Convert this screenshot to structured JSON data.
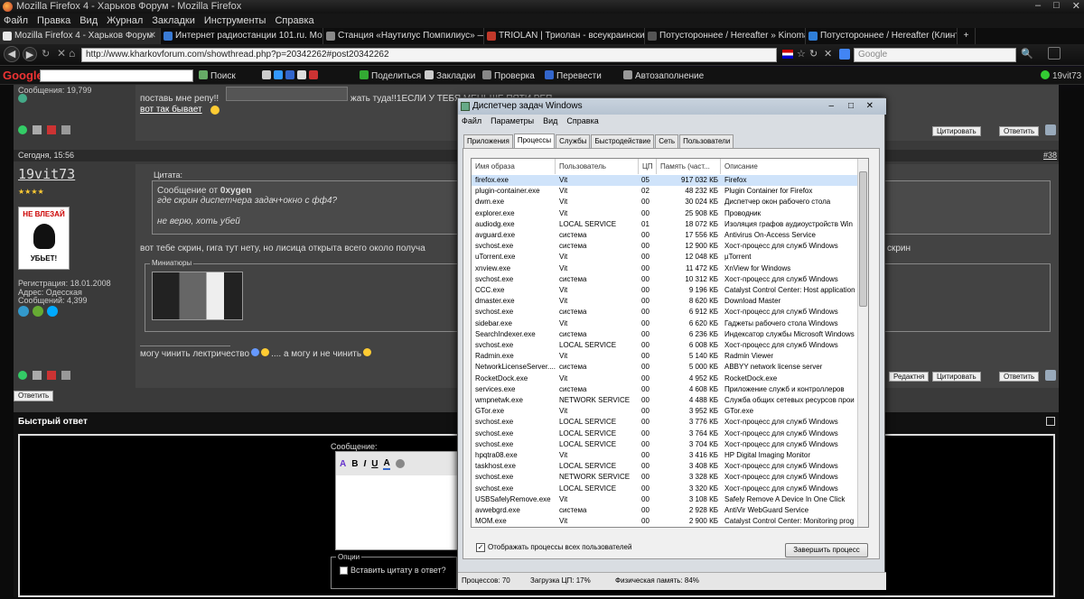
{
  "window": {
    "title": "Mozilla Firefox 4 - Харьков Форум - Mozilla Firefox"
  },
  "menubar": [
    "Файл",
    "Правка",
    "Вид",
    "Журнал",
    "Закладки",
    "Инструменты",
    "Справка"
  ],
  "tabs": [
    {
      "label": "Mozilla Firefox 4 - Харьков Форум",
      "color": "#e8e8e8"
    },
    {
      "label": "Интернет радиостанции 101.ru. Мо...",
      "color": "#3a7bd5"
    },
    {
      "label": "Станция «Наутилус Помпилиус» —...",
      "color": "#888888"
    },
    {
      "label": "TRIOLAN | Триолан - всеукраински...",
      "color": "#c0392b"
    },
    {
      "label": "Потустороннее / Hereafter » Kinoma...",
      "color": "#555555"
    },
    {
      "label": "Потустороннее / Hereafter (Клинт И...",
      "color": "#2f7ed8"
    }
  ],
  "nav": {
    "url": "http://www.kharkovforum.com/showthread.php?p=20342262#post20342262",
    "search_placeholder": "Google"
  },
  "googlebar": {
    "logo": "Google",
    "search": "Поиск",
    "share": "Поделиться",
    "bookmarks": "Закладки",
    "check": "Проверка",
    "translate": "Перевести",
    "autofill": "Автозаполнение",
    "user": "19vit73"
  },
  "forum": {
    "prev_post": {
      "messages": "Сообщения: 19,799",
      "line1": "поставь мне репу!!",
      "line2": "жать туда!!1ЕСЛИ У ТЕБЯ МЕНЬШЕ ПЯТИ РЕП",
      "line3": "вот так бывает",
      "quote_btn": "Цитировать",
      "reply_btn": "Ответить"
    },
    "post": {
      "date": "Сегодня, 15:56",
      "number": "#38",
      "author": "19vit73",
      "stars": "★★★★",
      "avatar_text1": "НЕ ВЛЕЗАЙ",
      "avatar_text2": "УБЬЕТ!",
      "reg": "Регистрация: 18.01.2008",
      "address": "Адрес: Одесская",
      "messages": "Сообщений: 4,399",
      "quote_label": "Цитата:",
      "quote_from_prefix": "Сообщение от",
      "quote_from": "0xygen",
      "quote_line1": "где скрин диспетчера задач+окно с фф4?",
      "quote_line2": "не верю, хоть убей",
      "text": "вот тебе скрин, гига тут нету, но лисица открыта всего около получа",
      "text_end": "скрин",
      "thumbs_label": "Миниатюры",
      "signature": "могу чинить лектричество",
      "signature2": ".... а могу и не чинить",
      "edit_btn": "Редактня",
      "quote_btn": "Цитировать",
      "reply_btn": "Ответить"
    },
    "reply_button": "Ответить",
    "quick_reply": {
      "title": "Быстрый ответ",
      "message_label": "Сообщение:",
      "options_label": "Опции",
      "quote_checkbox": "Вставить цитату в ответ?"
    }
  },
  "taskmgr": {
    "title": "Диспетчер задач Windows",
    "menu": [
      "Файл",
      "Параметры",
      "Вид",
      "Справка"
    ],
    "tabs": [
      "Приложения",
      "Процессы",
      "Службы",
      "Быстродействие",
      "Сеть",
      "Пользователи"
    ],
    "active_tab": "Процессы",
    "columns": [
      "Имя образа",
      "Пользователь",
      "ЦП",
      "Память (част...",
      "Описание"
    ],
    "rows": [
      [
        "firefox.exe",
        "Vit",
        "05",
        "917 032 КБ",
        "Firefox"
      ],
      [
        "plugin-container.exe",
        "Vit",
        "02",
        "48 232 КБ",
        "Plugin Container for Firefox"
      ],
      [
        "dwm.exe",
        "Vit",
        "00",
        "30 024 КБ",
        "Диспетчер окон рабочего стола"
      ],
      [
        "explorer.exe",
        "Vit",
        "00",
        "25 908 КБ",
        "Проводник"
      ],
      [
        "audiodg.exe",
        "LOCAL SERVICE",
        "01",
        "18 072 КБ",
        "Изоляция графов аудиоустройств Win"
      ],
      [
        "avguard.exe",
        "система",
        "00",
        "17 556 КБ",
        "Antivirus On-Access Service"
      ],
      [
        "svchost.exe",
        "система",
        "00",
        "12 900 КБ",
        "Хост-процесс для служб Windows"
      ],
      [
        "uTorrent.exe",
        "Vit",
        "00",
        "12 048 КБ",
        "µTorrent"
      ],
      [
        "xnview.exe",
        "Vit",
        "00",
        "11 472 КБ",
        "XnView for Windows"
      ],
      [
        "svchost.exe",
        "система",
        "00",
        "10 312 КБ",
        "Хост-процесс для служб Windows"
      ],
      [
        "CCC.exe",
        "Vit",
        "00",
        "9 196 КБ",
        "Catalyst Control Center: Host application"
      ],
      [
        "dmaster.exe",
        "Vit",
        "00",
        "8 620 КБ",
        "Download Master"
      ],
      [
        "svchost.exe",
        "система",
        "00",
        "6 912 КБ",
        "Хост-процесс для служб Windows"
      ],
      [
        "sidebar.exe",
        "Vit",
        "00",
        "6 620 КБ",
        "Гаджеты рабочего стола Windows"
      ],
      [
        "SearchIndexer.exe",
        "система",
        "00",
        "6 236 КБ",
        "Индексатор службы Microsoft Windows"
      ],
      [
        "svchost.exe",
        "LOCAL SERVICE",
        "00",
        "6 008 КБ",
        "Хост-процесс для служб Windows"
      ],
      [
        "Radmin.exe",
        "Vit",
        "00",
        "5 140 КБ",
        "Radmin Viewer"
      ],
      [
        "NetworkLicenseServer....",
        "система",
        "00",
        "5 000 КБ",
        "ABBYY network license server"
      ],
      [
        "RocketDock.exe",
        "Vit",
        "00",
        "4 952 КБ",
        "RocketDock.exe"
      ],
      [
        "services.exe",
        "система",
        "00",
        "4 608 КБ",
        "Приложение служб и контроллеров"
      ],
      [
        "wmpnetwk.exe",
        "NETWORK SERVICE",
        "00",
        "4 488 КБ",
        "Служба общих сетевых ресурсов прои"
      ],
      [
        "GTor.exe",
        "Vit",
        "00",
        "3 952 КБ",
        "GTor.exe"
      ],
      [
        "svchost.exe",
        "LOCAL SERVICE",
        "00",
        "3 776 КБ",
        "Хост-процесс для служб Windows"
      ],
      [
        "svchost.exe",
        "LOCAL SERVICE",
        "00",
        "3 764 КБ",
        "Хост-процесс для служб Windows"
      ],
      [
        "svchost.exe",
        "LOCAL SERVICE",
        "00",
        "3 704 КБ",
        "Хост-процесс для служб Windows"
      ],
      [
        "hpqtra08.exe",
        "Vit",
        "00",
        "3 416 КБ",
        "HP Digital Imaging Monitor"
      ],
      [
        "taskhost.exe",
        "LOCAL SERVICE",
        "00",
        "3 408 КБ",
        "Хост-процесс для служб Windows"
      ],
      [
        "svchost.exe",
        "NETWORK SERVICE",
        "00",
        "3 328 КБ",
        "Хост-процесс для служб Windows"
      ],
      [
        "svchost.exe",
        "LOCAL SERVICE",
        "00",
        "3 320 КБ",
        "Хост-процесс для служб Windows"
      ],
      [
        "USBSafelyRemove.exe",
        "Vit",
        "00",
        "3 108 КБ",
        "Safely Remove A Device In One Click"
      ],
      [
        "avwebgrd.exe",
        "система",
        "00",
        "2 928 КБ",
        "AntiVir WebGuard Service"
      ],
      [
        "MOM.exe",
        "Vit",
        "00",
        "2 900 КБ",
        "Catalyst Control Center: Monitoring prog"
      ]
    ],
    "show_all": "Отображать процессы всех пользователей",
    "end_process": "Завершить процесс",
    "status": {
      "processes": "Процессов: 70",
      "cpu": "Загрузка ЦП: 17%",
      "memory": "Физическая память: 84%"
    }
  }
}
